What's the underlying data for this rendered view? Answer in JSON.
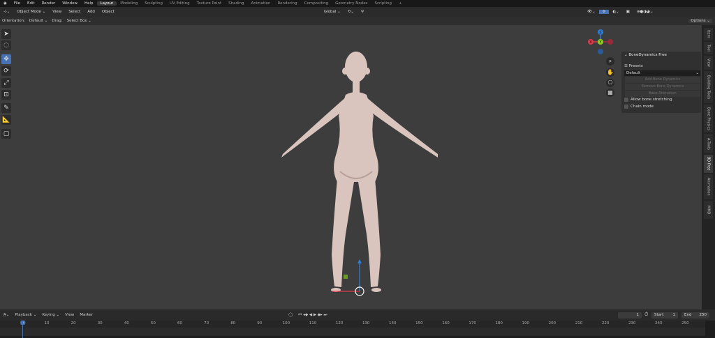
{
  "menu": [
    "File",
    "Edit",
    "Render",
    "Window",
    "Help"
  ],
  "workspaces": [
    "Layout",
    "Modeling",
    "Sculpting",
    "UV Editing",
    "Texture Paint",
    "Shading",
    "Animation",
    "Rendering",
    "Compositing",
    "Geometry Nodes",
    "Scripting",
    "+"
  ],
  "active_workspace": "Layout",
  "header": {
    "mode": "Object Mode ⌄",
    "items": [
      "View",
      "Select",
      "Add",
      "Object"
    ],
    "transform": "Global ⌄"
  },
  "toolsettings": {
    "orientation_label": "Orientation:",
    "orientation_value": "Default ⌄",
    "drag_label": "Drag:",
    "drag_value": "Select Box ⌄",
    "options": "Options ⌄"
  },
  "gizmo": {
    "x": "X",
    "y": "Y",
    "z": "Z"
  },
  "panel": {
    "title": "⌄ BoneDynamics Free",
    "presets": "Presets",
    "preset_value": "Default",
    "buttons": [
      "Add Bone Dynamics",
      "Remove Bone Dynamics",
      "Bake Animation"
    ],
    "checkboxes": [
      "Allow bone stretching",
      "Chain mode"
    ]
  },
  "sidebar_tabs": [
    "Item",
    "Tool",
    "View",
    "Building Tools",
    "Bone Physics",
    "A-Tools",
    "BD Free",
    "Animation",
    "MMD"
  ],
  "active_sidebar_tab": "BD Free",
  "timeline": {
    "menus": [
      "Playback ⌄",
      "Keying ⌄",
      "View",
      "Marker"
    ],
    "current_frame": "1",
    "start_label": "Start",
    "start": "1",
    "end_label": "End",
    "end": "250",
    "ticks": [
      "1",
      "10",
      "20",
      "30",
      "40",
      "50",
      "60",
      "70",
      "80",
      "90",
      "100",
      "110",
      "120",
      "130",
      "140",
      "150",
      "160",
      "170",
      "180",
      "190",
      "200",
      "210",
      "220",
      "230",
      "240",
      "250"
    ]
  },
  "colors": {
    "accent": "#4772b3",
    "x_axis": "#e0394a",
    "y_axis": "#8ccf1f",
    "z_axis": "#2f7fd8",
    "skin": "#d9c4be"
  }
}
